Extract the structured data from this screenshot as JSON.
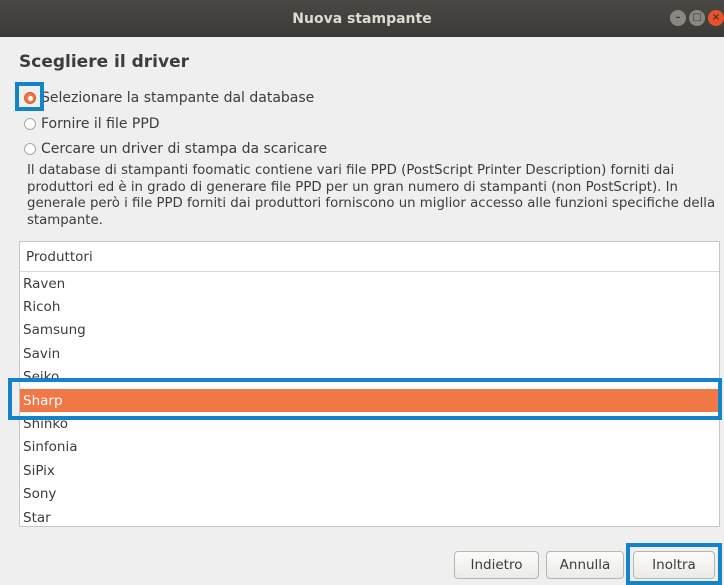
{
  "window": {
    "title": "Nuova stampante",
    "controls": [
      "minimize-icon",
      "maximize-icon",
      "close-icon"
    ]
  },
  "heading": "Scegliere il driver",
  "options": [
    {
      "label": "Selezionare la stampante dal database",
      "selected": true
    },
    {
      "label": "Fornire il file PPD",
      "selected": false
    },
    {
      "label": "Cercare un driver di stampa da scaricare",
      "selected": false
    }
  ],
  "description": "Il database di stampanti foomatic contiene vari file PPD (PostScript Printer Description) forniti dai produttori ed è in grado di generare file PPD per un gran numero di stampanti (non PostScript). In generale però i file PPD forniti dai produttori forniscono un miglior accesso alle funzioni specifiche della stampante.",
  "manufacturers": {
    "header": "Produttori",
    "items": [
      "Raven",
      "Ricoh",
      "Samsung",
      "Savin",
      "Seiko",
      "Sharp",
      "Shinko",
      "Sinfonia",
      "SiPix",
      "Sony",
      "Star"
    ],
    "selected": "Sharp"
  },
  "buttons": {
    "back": "Indietro",
    "cancel": "Annulla",
    "forward": "Inoltra"
  },
  "colors": {
    "accent": "#f07746",
    "highlight_box": "#1284c7",
    "titlebar": "#3b3a37"
  }
}
